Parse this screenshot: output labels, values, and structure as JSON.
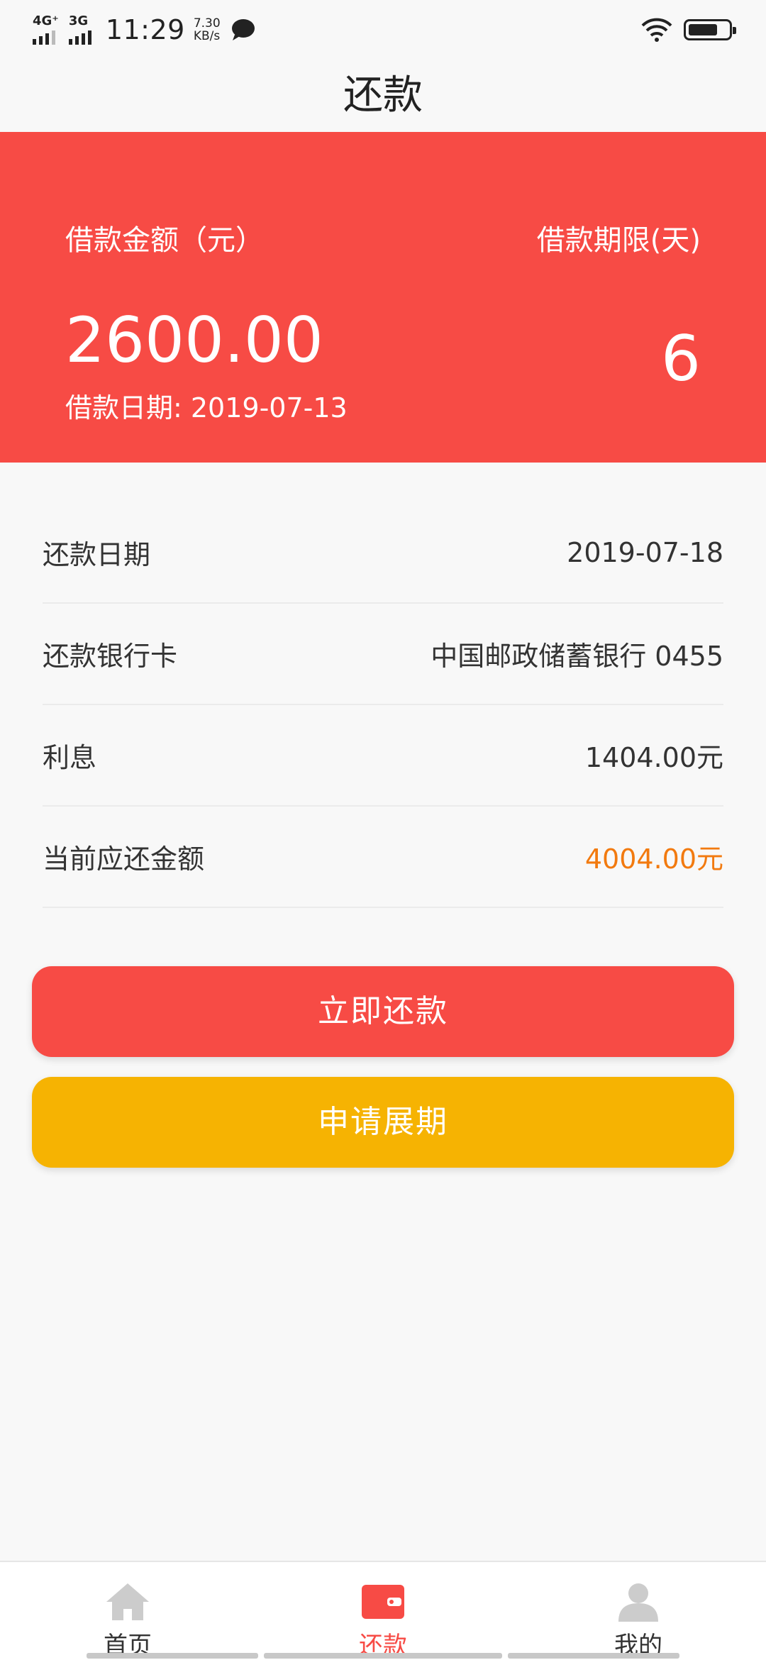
{
  "status_bar": {
    "network1": "4G⁺",
    "network2": "3G",
    "time": "11:29",
    "speed_value": "7.30",
    "speed_unit": "KB/s",
    "icons": [
      "signal-icon",
      "chat-bubble-icon",
      "wifi-icon",
      "battery-icon"
    ]
  },
  "header": {
    "title": "还款"
  },
  "loan_card": {
    "amount_label": "借款金额（元）",
    "amount": "2600.00",
    "term_label": "借款期限(天)",
    "term": "6",
    "date_text": "借款日期: 2019-07-13"
  },
  "details": [
    {
      "label": "还款日期",
      "value": "2019-07-18"
    },
    {
      "label": "还款银行卡",
      "value": "中国邮政储蓄银行  0455"
    },
    {
      "label": "利息",
      "value": "1404.00元"
    },
    {
      "label": "当前应还金额",
      "value": "4004.00元"
    }
  ],
  "buttons": {
    "repay_now": "立即还款",
    "apply_extension": "申请展期"
  },
  "tabs": [
    {
      "label": "首页",
      "icon": "home-icon"
    },
    {
      "label": "还款",
      "icon": "wallet-icon",
      "active": true
    },
    {
      "label": "我的",
      "icon": "user-icon"
    }
  ],
  "colors": {
    "accent_red": "#f74b45",
    "accent_yellow": "#f6b302",
    "highlight_orange": "#f27a0f"
  }
}
